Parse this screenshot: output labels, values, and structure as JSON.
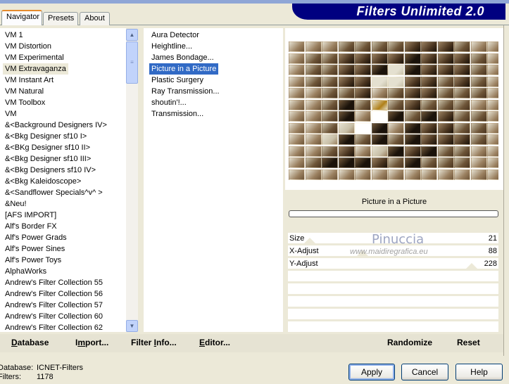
{
  "title": "Filters Unlimited 2.0",
  "tabs": [
    {
      "label": "Navigator",
      "active": true
    },
    {
      "label": "Presets"
    },
    {
      "label": "About"
    }
  ],
  "categories": {
    "selected": "VM Extravaganza",
    "items": [
      "VM 1",
      "VM Distortion",
      "VM Experimental",
      "VM Extravaganza",
      "VM Instant Art",
      "VM Natural",
      "VM Toolbox",
      "VM",
      "&<Background Designers IV>",
      "&<Bkg Designer sf10 I>",
      "&<BKg Designer sf10 II>",
      "&<Bkg Designer sf10 III>",
      "&<Bkg Designers sf10 IV>",
      "&<Bkg Kaleidoscope>",
      "&<Sandflower Specials^v^ >",
      "&Neu!",
      "[AFS IMPORT]",
      "Alf's Border FX",
      "Alf's Power Grads",
      "Alf's Power Sines",
      "Alf's Power Toys",
      "AlphaWorks",
      "Andrew's Filter Collection 55",
      "Andrew's Filter Collection 56",
      "Andrew's Filter Collection 57",
      "Andrew's Filter Collection 60",
      "Andrew's Filter Collection 62"
    ]
  },
  "filters": {
    "selected": "Picture in a Picture",
    "items": [
      " Aura Detector",
      "Heightline...",
      "James Bondage...",
      "Picture in a Picture",
      "Plastic Surgery",
      "Ray Transmission...",
      "shoutin'!...",
      "Transmission..."
    ]
  },
  "preview": {
    "filter_name": "Picture in a Picture",
    "progress": 0
  },
  "sliders": [
    {
      "label": "Size",
      "value": 21,
      "max": 255
    },
    {
      "label": "X-Adjust",
      "value": 88,
      "max": 255
    },
    {
      "label": "Y-Adjust",
      "value": 228,
      "max": 255
    }
  ],
  "watermark": {
    "name": "Pinuccia",
    "url": "www.maidiregrafica.eu"
  },
  "left_buttons": [
    {
      "pre": "",
      "u": "D",
      "post": "atabase"
    },
    {
      "pre": "I",
      "u": "m",
      "post": "port..."
    },
    {
      "pre": "Filter ",
      "u": "I",
      "post": "nfo..."
    },
    {
      "pre": "",
      "u": "E",
      "post": "ditor..."
    }
  ],
  "right_buttons": {
    "randomize": "Randomize",
    "reset": "Reset"
  },
  "status": {
    "database_label": "Database:",
    "database_value": "ICNET-Filters",
    "filters_label": "Filters:",
    "filters_value": "1178"
  },
  "dialog_buttons": {
    "apply": "Apply",
    "cancel": "Cancel",
    "help": "Help"
  },
  "colors": {
    "banner": "#000080",
    "selection": "#316ac5",
    "background": "#ece9d8"
  }
}
